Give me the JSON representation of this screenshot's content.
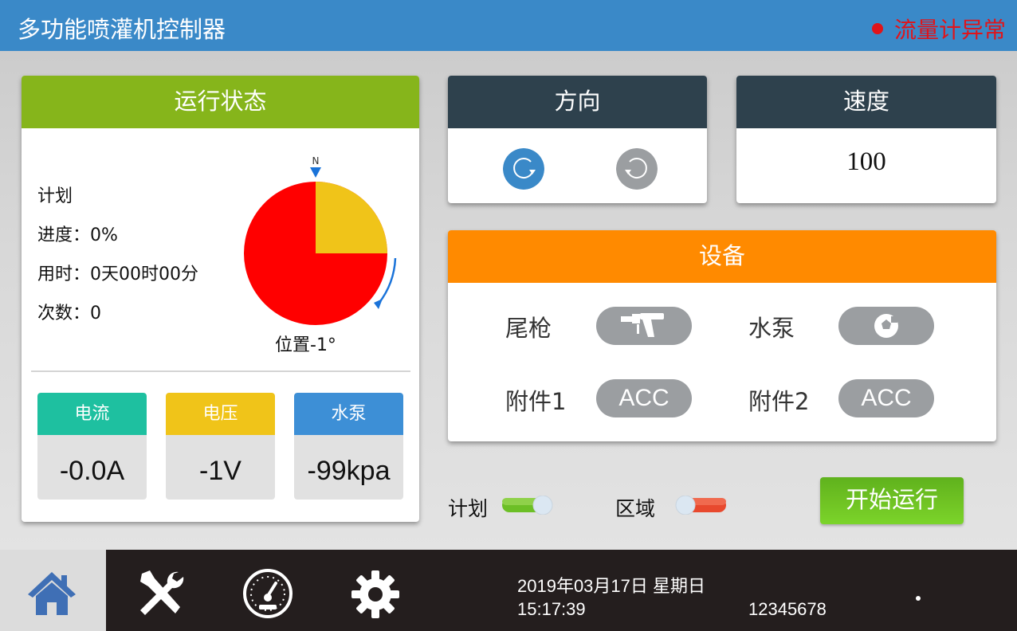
{
  "header": {
    "title": "多功能喷灌机控制器",
    "alarm": "流量计异常"
  },
  "status": {
    "title": "运行状态",
    "plan_label": "计划",
    "progress": "进度：0%",
    "elapsed": "用时：0天00时00分",
    "count": "次数：0",
    "compass_north": "N",
    "position": "位置-1°",
    "meters": [
      {
        "label": "电流",
        "value": "-0.0A",
        "color": "#1ec0a0"
      },
      {
        "label": "电压",
        "value": "-1V",
        "color": "#f0c419"
      },
      {
        "label": "水泵",
        "value": "-99kpa",
        "color": "#3d8fd6"
      }
    ]
  },
  "direction": {
    "title": "方向",
    "clockwise_icon": "rotate-clockwise-icon",
    "counter_icon": "rotate-counterclockwise-icon"
  },
  "speed": {
    "title": "速度",
    "value": "100"
  },
  "device": {
    "title": "设备",
    "items": [
      {
        "label": "尾枪",
        "icon": "spray-gun-icon"
      },
      {
        "label": "水泵",
        "icon": "pump-icon"
      },
      {
        "label": "附件1",
        "button": "ACC"
      },
      {
        "label": "附件2",
        "button": "ACC"
      }
    ]
  },
  "toggles": {
    "plan_label": "计划",
    "area_label": "区域"
  },
  "start_button": "开始运行",
  "nav": {
    "items": [
      "home-icon",
      "tools-icon",
      "gauge-icon",
      "gear-icon"
    ],
    "date": "2019年03月17日 星期日",
    "time": "15:17:39",
    "code": "12345678"
  },
  "colors": {
    "header": "#3a89c8",
    "status_header": "#86b51b",
    "dark_header": "#2e414d",
    "device_header": "#ff8a00",
    "alarm": "#e0141a",
    "start": "#6fc223"
  }
}
